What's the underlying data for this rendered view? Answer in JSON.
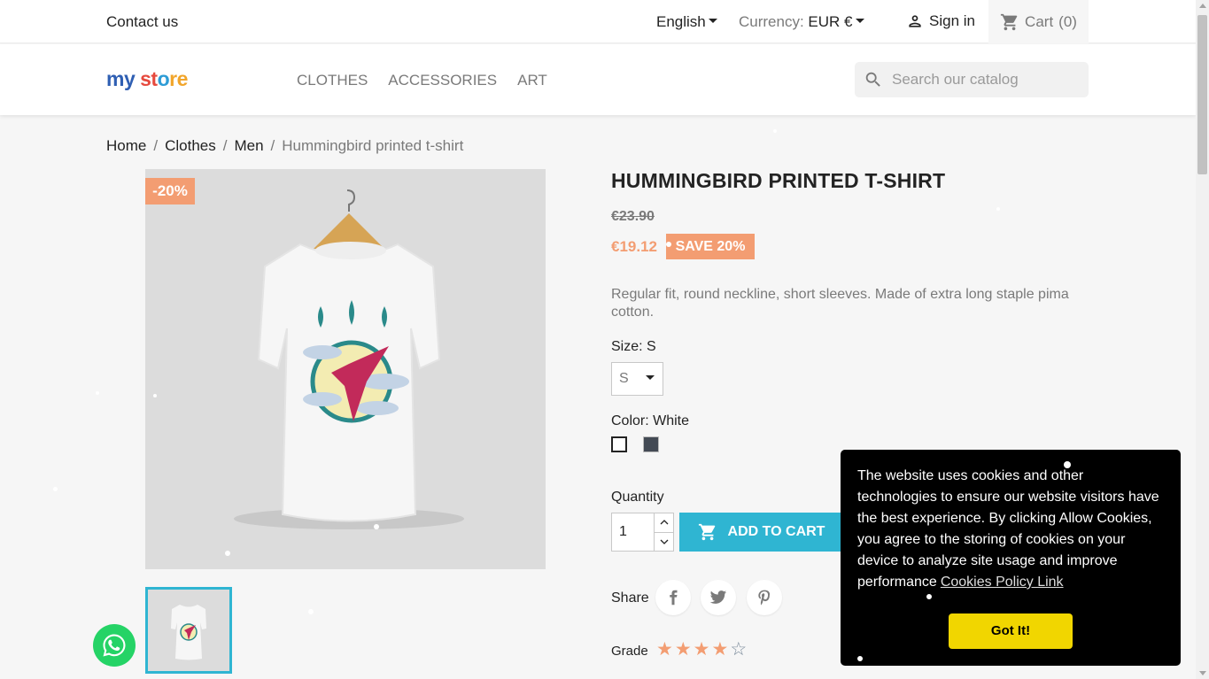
{
  "topbar": {
    "contact_label": "Contact us",
    "language": "English",
    "currency_label": "Currency:",
    "currency_value": "EUR €",
    "signin_label": "Sign in",
    "cart_label": "Cart",
    "cart_count": "(0)"
  },
  "header": {
    "logo": {
      "part1": "my",
      "part2": "st",
      "part3": "o",
      "part4": "re"
    },
    "nav": [
      "CLOTHES",
      "ACCESSORIES",
      "ART"
    ],
    "search_placeholder": "Search our catalog"
  },
  "breadcrumb": {
    "items": [
      "Home",
      "Clothes",
      "Men"
    ],
    "current": "Hummingbird printed t-shirt",
    "separator": "/"
  },
  "product": {
    "discount_badge": "-20%",
    "title": "HUMMINGBIRD PRINTED T-SHIRT",
    "old_price": "€23.90",
    "price": "€19.12",
    "save_label": "SAVE 20%",
    "description": "Regular fit, round neckline, short sleeves. Made of extra long staple pima cotton.",
    "size_label": "Size: S",
    "size_selected": "S",
    "color_label": "Color: White",
    "colors": [
      "#ffffff",
      "#434a54"
    ],
    "quantity_label": "Quantity",
    "quantity_value": "1",
    "add_to_cart_label": "ADD TO CART",
    "share_label": "Share",
    "grade_label": "Grade",
    "rating": 4,
    "rating_max": 5
  },
  "cookie": {
    "text": "The website uses cookies and other technologies to ensure our website visitors have the best experience. By clicking Allow Cookies, you agree to the storing of cookies on your device to analyze site usage and improve performance",
    "link_label": "Cookies Policy Link",
    "button_label": "Got It!"
  },
  "colors": {
    "accent": "#2fb5d2",
    "sale": "#f39d72",
    "cookie_button": "#f1d600",
    "whatsapp": "#25d366"
  }
}
